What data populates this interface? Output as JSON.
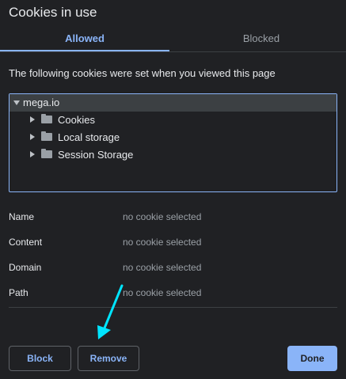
{
  "dialog": {
    "title": "Cookies in use"
  },
  "tabs": [
    {
      "label": "Allowed",
      "selected": true
    },
    {
      "label": "Blocked",
      "selected": false
    }
  ],
  "intro_text": "The following cookies were set when you viewed this page",
  "tree": {
    "root": {
      "label": "mega.io",
      "expanded": true,
      "icon": "triangle-down-icon"
    },
    "items": [
      {
        "label": "Cookies",
        "icon": "folder-icon"
      },
      {
        "label": "Local storage",
        "icon": "folder-icon"
      },
      {
        "label": "Session Storage",
        "icon": "folder-icon"
      }
    ]
  },
  "details": [
    {
      "name": "Name",
      "value": "no cookie selected"
    },
    {
      "name": "Content",
      "value": "no cookie selected"
    },
    {
      "name": "Domain",
      "value": "no cookie selected"
    },
    {
      "name": "Path",
      "value": "no cookie selected"
    }
  ],
  "buttons": {
    "block": "Block",
    "remove": "Remove",
    "done": "Done"
  },
  "annotation": {
    "icon": "arrow-icon",
    "color": "#00e5ff"
  },
  "colors": {
    "accent": "#8ab4f8",
    "background": "#202124",
    "muted_text": "#9aa0a6"
  }
}
